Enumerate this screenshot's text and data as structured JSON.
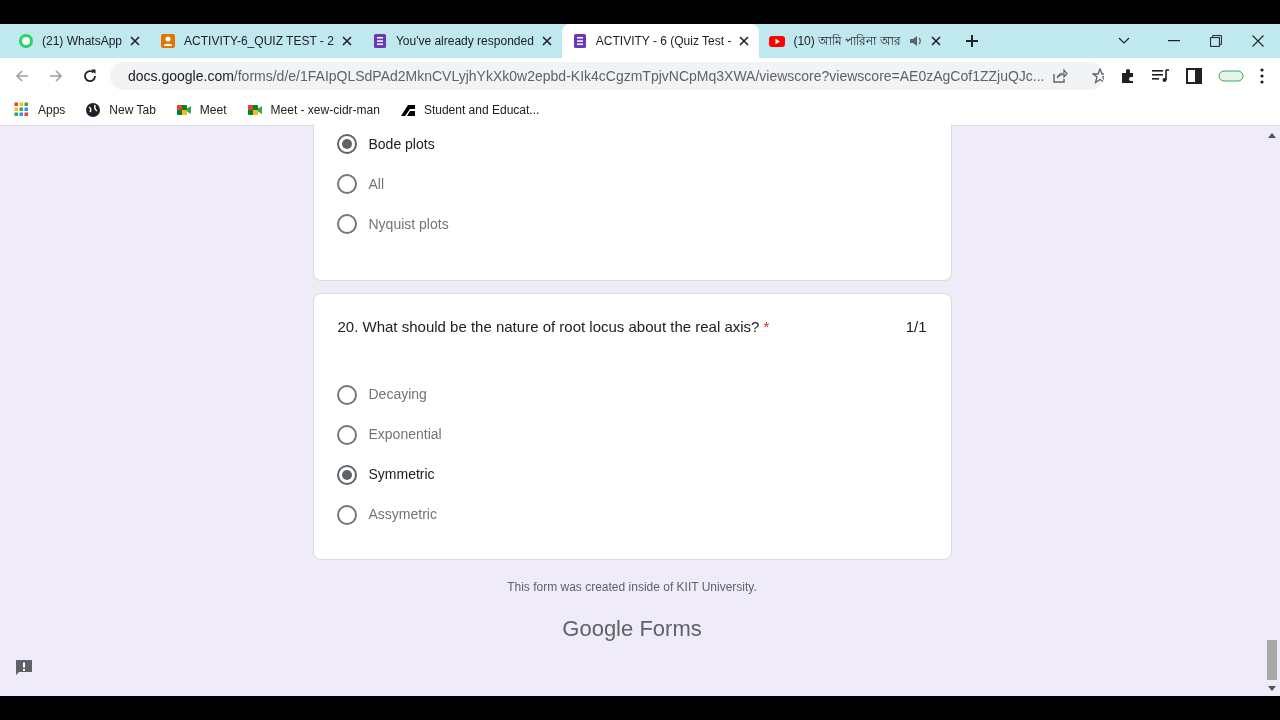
{
  "tabs": [
    {
      "title": "(21) WhatsApp",
      "kind": "whatsapp",
      "selected": false,
      "audio": false
    },
    {
      "title": "ACTIVITY-6_QUIZ TEST - 2",
      "kind": "classroom",
      "selected": false,
      "audio": false
    },
    {
      "title": "You've already responded",
      "kind": "forms",
      "selected": false,
      "audio": false
    },
    {
      "title": "ACTIVITY - 6 (Quiz Test -",
      "kind": "forms",
      "selected": true,
      "audio": false
    },
    {
      "title": "(10) আমি পারিনা আর",
      "kind": "youtube",
      "selected": false,
      "audio": true
    }
  ],
  "url": {
    "host": "docs.google.com",
    "path": "/forms/d/e/1FAIpQLSdPAd2MknCVLyjhYkXk0w2epbd-KIk4cCgzmTpjvNCpMq3XWA/viewscore?viewscore=AE0zAgCof1ZZjuQJc..."
  },
  "bookmarks": [
    {
      "label": "Apps",
      "kind": "apps"
    },
    {
      "label": "New Tab",
      "kind": "globe"
    },
    {
      "label": "Meet",
      "kind": "meet"
    },
    {
      "label": "Meet - xew-cidr-man",
      "kind": "meet"
    },
    {
      "label": "Student and Educat...",
      "kind": "student"
    }
  ],
  "cards": [
    {
      "options": [
        {
          "label": "Bode plots",
          "selected": true
        },
        {
          "label": "All",
          "selected": false
        },
        {
          "label": "Nyquist plots",
          "selected": false
        }
      ]
    },
    {
      "question": "20. What should be the nature of root locus about the real axis?",
      "required_mark": "*",
      "score": "1/1",
      "options": [
        {
          "label": "Decaying",
          "selected": false
        },
        {
          "label": "Exponential",
          "selected": false
        },
        {
          "label": "Symmetric",
          "selected": true
        },
        {
          "label": "Assymetric",
          "selected": false
        }
      ]
    }
  ],
  "footer": "This form was created inside of KIIT University.",
  "brand": {
    "google": "Google",
    "product": "Forms"
  }
}
